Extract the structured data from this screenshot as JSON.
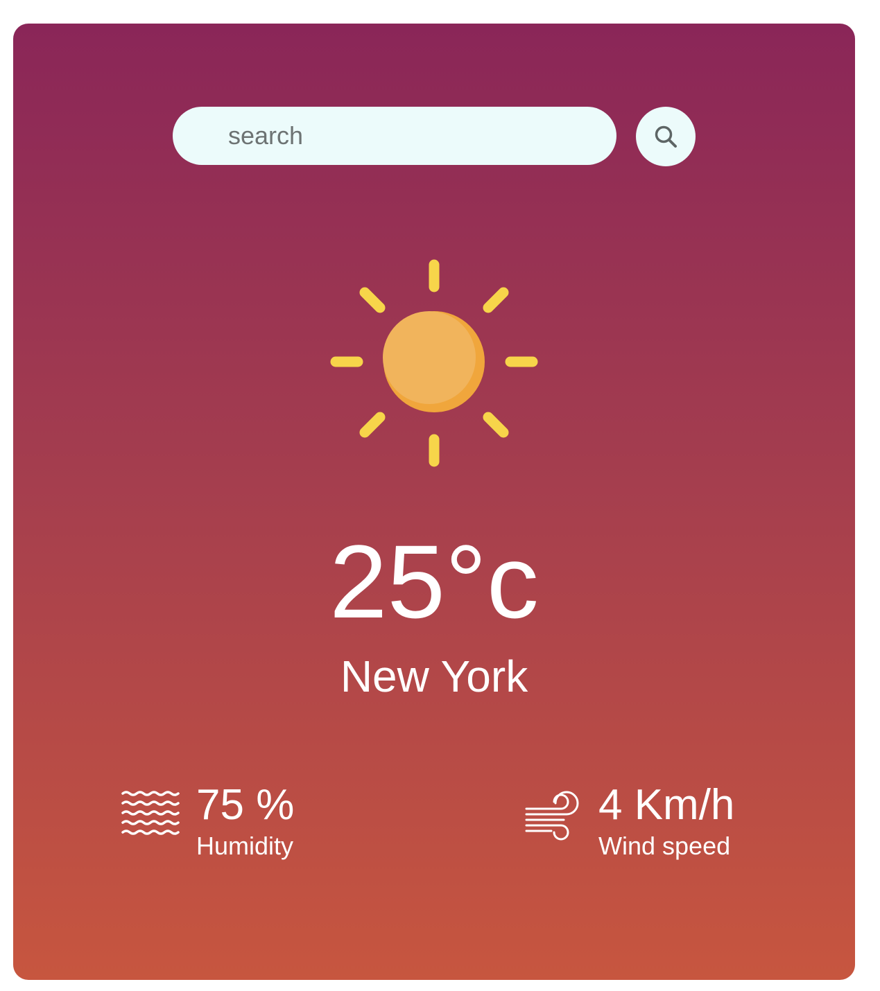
{
  "search": {
    "placeholder": "search"
  },
  "icons": {
    "search_button": "search-icon",
    "weather": "sun-icon",
    "humidity": "humidity-waves-icon",
    "wind": "wind-icon"
  },
  "weather": {
    "temperature": "25°c",
    "city": "New York"
  },
  "humidity": {
    "value": "75 %",
    "label": "Humidity"
  },
  "wind": {
    "value": "4 Km/h",
    "label": "Wind speed"
  },
  "colors": {
    "gradient_top": "#8a2658",
    "gradient_bottom": "#c7563f",
    "search_bg": "#ecfbfb",
    "sun_fill": "#f0b35a",
    "sun_rays": "#f7d54a",
    "text": "#ffffff"
  }
}
